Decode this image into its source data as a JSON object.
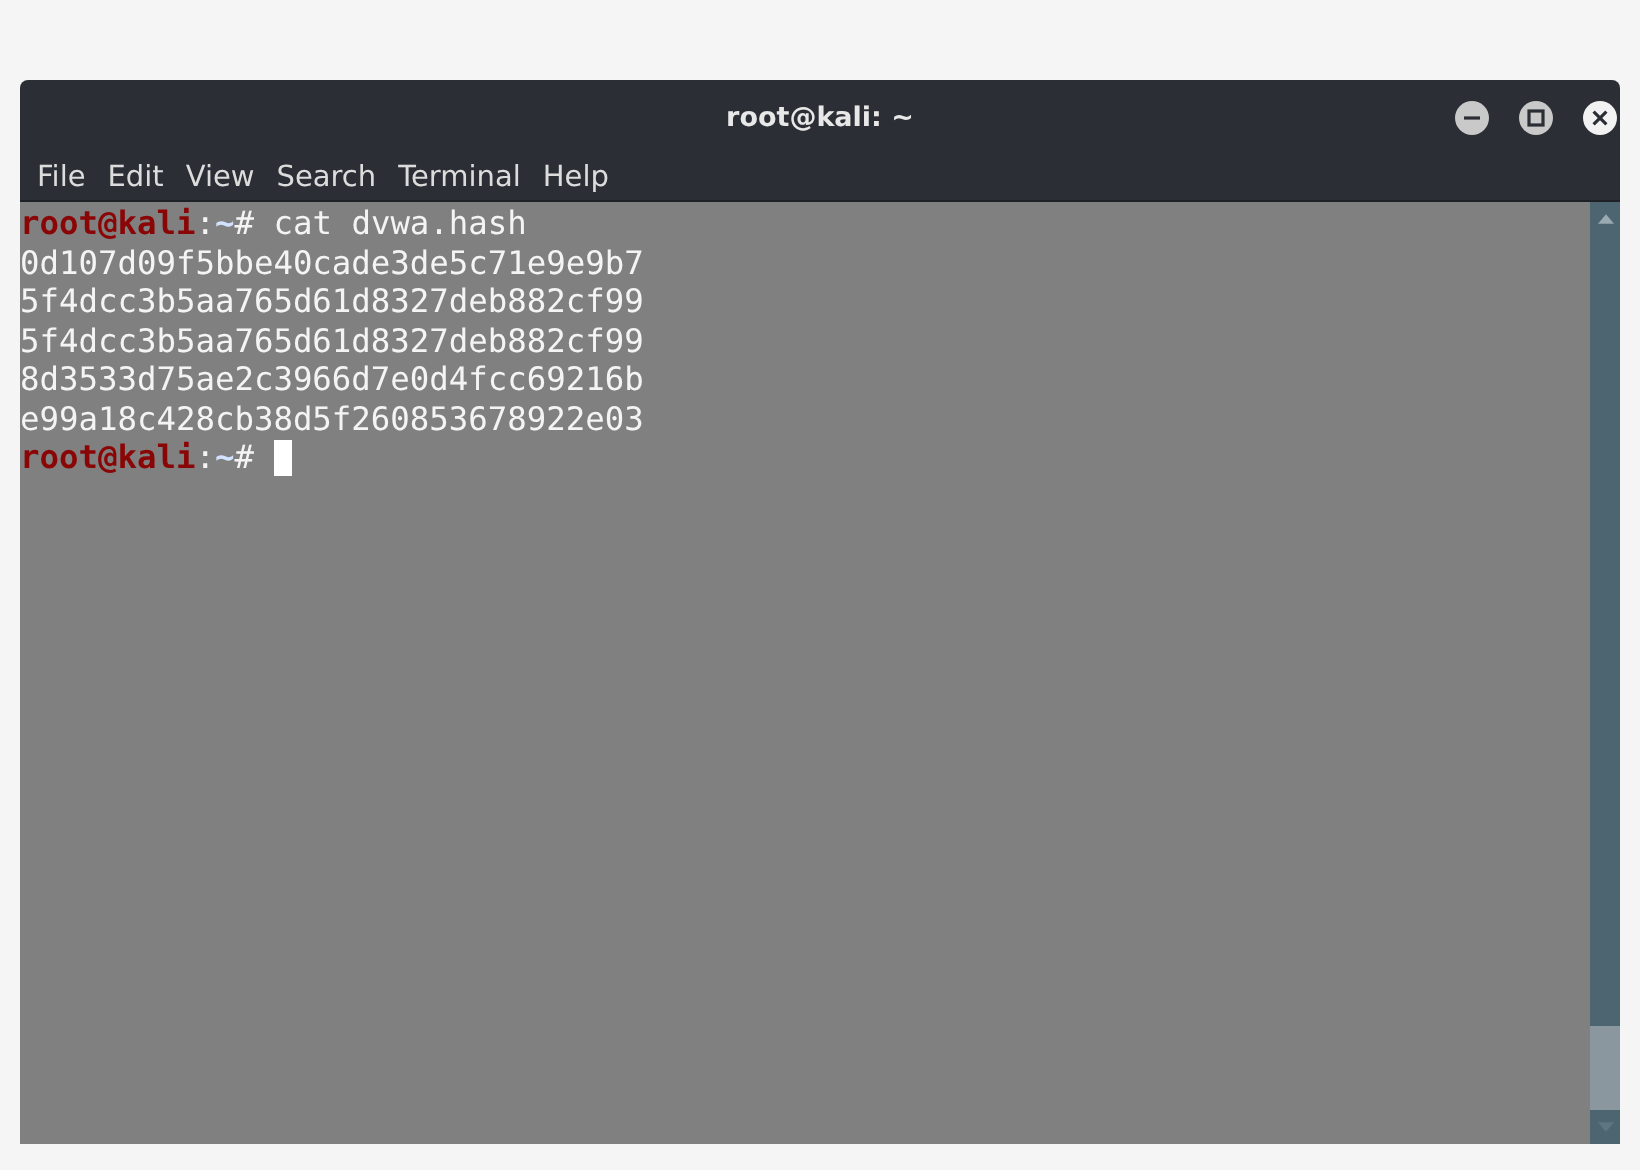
{
  "window": {
    "title": "root@kali: ~"
  },
  "menu": [
    "File",
    "Edit",
    "View",
    "Search",
    "Terminal",
    "Help"
  ],
  "terminal": {
    "lines": [
      {
        "kind": "prompt",
        "user": "root@kali",
        "separator": ":",
        "path": "~",
        "symbol": "#",
        "command": "cat dvwa.hash",
        "cursor": false
      },
      {
        "kind": "output",
        "text": "0d107d09f5bbe40cade3de5c71e9e9b7"
      },
      {
        "kind": "output",
        "text": "5f4dcc3b5aa765d61d8327deb882cf99"
      },
      {
        "kind": "output",
        "text": "5f4dcc3b5aa765d61d8327deb882cf99"
      },
      {
        "kind": "output",
        "text": "8d3533d75ae2c3966d7e0d4fcc69216b"
      },
      {
        "kind": "output",
        "text": "e99a18c428cb38d5f260853678922e03"
      },
      {
        "kind": "prompt",
        "user": "root@kali",
        "separator": ":",
        "path": "~",
        "symbol": "#",
        "cursor": true
      }
    ]
  }
}
